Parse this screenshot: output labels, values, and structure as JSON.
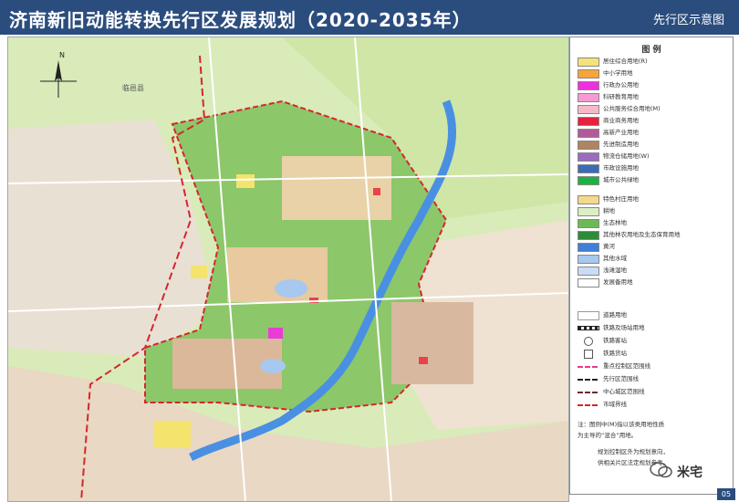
{
  "header": {
    "title": "济南新旧动能转换先行区发展规划（2020-2035年）",
    "subtitle": "先行区示意图",
    "bg_color": "#2b4d7e"
  },
  "map": {
    "north_label": "N",
    "places": {
      "linyi": "临邑县"
    },
    "colors": {
      "farmland": "#d9ebb8",
      "forest": "#7fbf63",
      "river": "#4a90e2",
      "city": "#e9d9c8",
      "residential": "#f4e36c",
      "commercial": "#e8434a",
      "industrial": "#b9845f",
      "administrative": "#e93bd6",
      "boundary": "#d6262d"
    }
  },
  "legend": {
    "title": "图 例",
    "items": [
      {
        "label": "居住综合用地(R)",
        "color": "#f6e27a"
      },
      {
        "label": "中小学用地",
        "color": "#f7a43b"
      },
      {
        "label": "行政办公用地",
        "color": "#f02fe0"
      },
      {
        "label": "科研教育用地",
        "color": "#f59ad2"
      },
      {
        "label": "公共服务综合用地(M)",
        "color": "#f7b9c8"
      },
      {
        "label": "商业商务用地",
        "color": "#e5213f"
      },
      {
        "label": "高新产业用地",
        "color": "#b35a9a"
      },
      {
        "label": "先进制造用地",
        "color": "#b08462"
      },
      {
        "label": "物流仓储用地(W)",
        "color": "#9b6bc2"
      },
      {
        "label": "市政设施用地",
        "color": "#3a6cb8"
      },
      {
        "label": "城市公共绿地",
        "color": "#1bb33f"
      },
      {
        "label": "特色村庄用地",
        "color": "#f3d98d"
      },
      {
        "label": "耕地",
        "color": "#dcefc3"
      },
      {
        "label": "生态林地",
        "color": "#6cba55"
      },
      {
        "label": "其他林农用地及生态保育用地",
        "color": "#2e8b3a"
      },
      {
        "label": "黄河",
        "color": "#3f7fd6"
      },
      {
        "label": "其他水域",
        "color": "#a7c8ef"
      },
      {
        "label": "浅滩湿地",
        "color": "#c9dcf5"
      },
      {
        "label": "发展备用地",
        "color": "#ffffff"
      }
    ],
    "line_items": [
      {
        "label": "道路用地"
      },
      {
        "label": "铁路及场站用地"
      },
      {
        "label": "铁路客站"
      },
      {
        "label": "铁路货站"
      },
      {
        "label": "重点控制区范围线"
      },
      {
        "label": "先行区范围线"
      },
      {
        "label": "中心城区范围线"
      },
      {
        "label": "市域界线"
      }
    ],
    "notes": [
      "注：图例中(M)指以该类用地性质",
      "为主导的“混合”用地。",
      "规划控制区外为规划意向，",
      "供相关片区法定规划参考。"
    ]
  },
  "watermark": "米宅",
  "page_number": "05"
}
